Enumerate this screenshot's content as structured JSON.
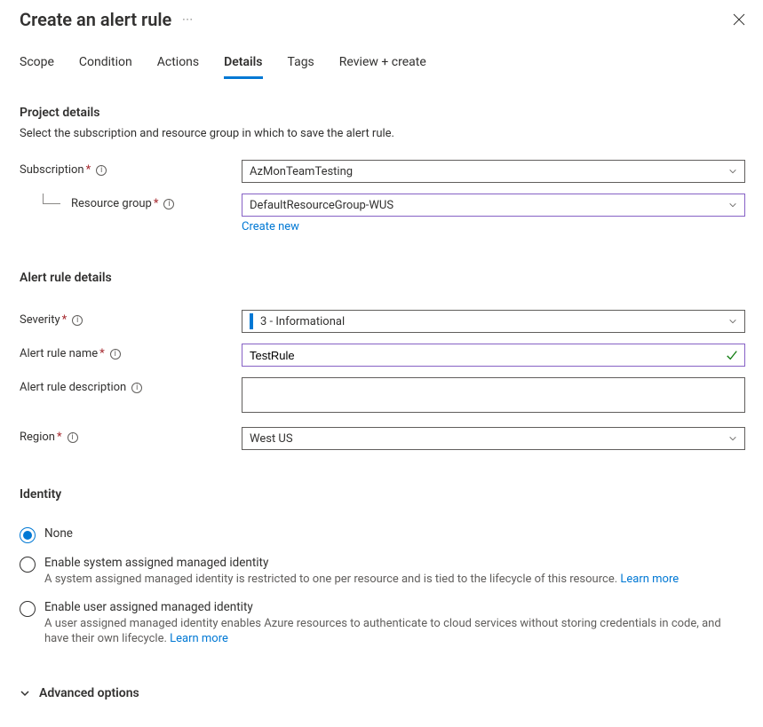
{
  "header": {
    "title": "Create an alert rule"
  },
  "tabs": {
    "items": [
      "Scope",
      "Condition",
      "Actions",
      "Details",
      "Tags",
      "Review + create"
    ],
    "active": "Details"
  },
  "project": {
    "heading": "Project details",
    "sub": "Select the subscription and resource group in which to save the alert rule.",
    "subscription_label": "Subscription",
    "subscription_value": "AzMonTeamTesting",
    "rg_label": "Resource group",
    "rg_value": "DefaultResourceGroup-WUS",
    "create_new": "Create new"
  },
  "details": {
    "heading": "Alert rule details",
    "severity_label": "Severity",
    "severity_value": "3 - Informational",
    "name_label": "Alert rule name",
    "name_value": "TestRule",
    "desc_label": "Alert rule description",
    "desc_value": "",
    "region_label": "Region",
    "region_value": "West US"
  },
  "identity": {
    "heading": "Identity",
    "none_label": "None",
    "sys_label": "Enable system assigned managed identity",
    "sys_desc": "A system assigned managed identity is restricted to one per resource and is tied to the lifecycle of this resource. ",
    "user_label": "Enable user assigned managed identity",
    "user_desc": "A user assigned managed identity enables Azure resources to authenticate to cloud services without storing credentials in code, and have their own lifecycle. ",
    "learn_more": "Learn more"
  },
  "advanced": {
    "label": "Advanced options"
  }
}
